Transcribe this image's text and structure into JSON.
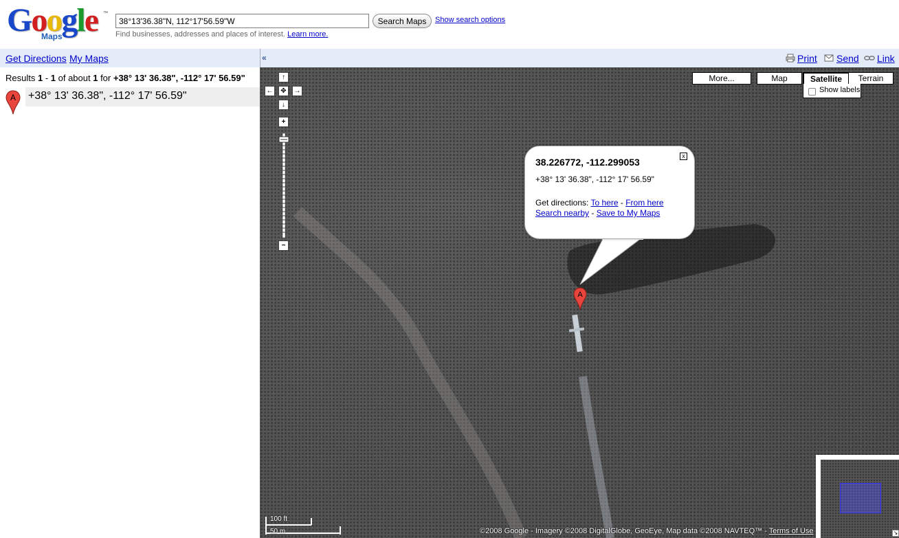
{
  "header": {
    "logo_word": "Google",
    "logo_tm": "™",
    "logo_sub": "Maps",
    "search_value": "38°13'36.38\"N, 112°17'56.59\"W",
    "search_button": "Search Maps",
    "show_options": "Show search options",
    "hint_text": "Find businesses, addresses and places of interest.",
    "learn_more": "Learn more."
  },
  "leftbar": {
    "get_directions": "Get Directions",
    "my_maps": "My Maps"
  },
  "toolbar": {
    "collapse": "«",
    "print": "Print",
    "send": "Send",
    "link": "Link"
  },
  "results": {
    "prefix": "Results ",
    "from": "1",
    "dash": " - ",
    "to": "1",
    "of_about": " of about ",
    "count": "1",
    "for": " for ",
    "query": "+38° 13' 36.38\", -112° 17' 56.59\"",
    "item_label": "+38° 13' 36.38\", -112° 17' 56.59\"",
    "marker_letter": "A"
  },
  "map_types": {
    "more": "More...",
    "map": "Map",
    "satellite": "Satellite",
    "terrain": "Terrain",
    "show_labels": "Show labels",
    "selected": "Satellite"
  },
  "info_window": {
    "title": "38.226772, -112.299053",
    "dms": "+38° 13' 36.38\", -112° 17' 56.59\"",
    "get_directions": "Get directions: ",
    "to_here": "To here",
    "from_here": "From here",
    "sep": " - ",
    "search_nearby": "Search nearby",
    "save_to_my_maps": "Save to My Maps",
    "close_symbol": "x"
  },
  "map_marker": {
    "letter": "A"
  },
  "scale": {
    "feet": "100 ft",
    "meters": "50 m"
  },
  "copyright": {
    "text": "©2008 Google - Imagery ©2008 DigitalGlobe, GeoEye, Map data ©2008 NAVTEQ™ - ",
    "terms": "Terms of Use"
  },
  "colors": {
    "link": "#0000cc",
    "bar_bg": "#e5ecf9",
    "marker_red": "#e8453c"
  }
}
